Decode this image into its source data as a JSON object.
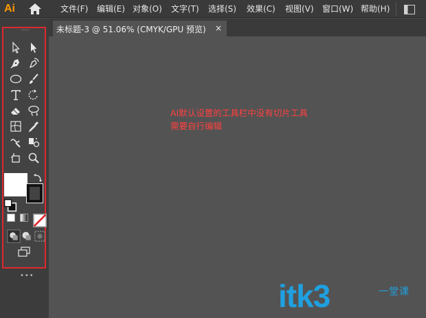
{
  "app": {
    "logo_text": "Ai",
    "accent_color": "#ff9a00"
  },
  "menu": {
    "items": [
      "文件(F)",
      "编辑(E)",
      "对象(O)",
      "文字(T)",
      "选择(S)",
      "效果(C)",
      "视图(V)",
      "窗口(W)",
      "帮助(H)"
    ]
  },
  "document_tab": {
    "label": "未标题-3 @ 51.06% (CMYK/GPU 预览)",
    "close_glyph": "×"
  },
  "annotation": {
    "text": "AI默认设置的工具栏中没有切片工具\n需要自行编辑",
    "color": "#ff4040"
  },
  "toolbar": {
    "highlight_color": "#e0282e",
    "tools": [
      "selection-tool-icon",
      "direct-selection-tool-icon",
      "pen-tool-icon",
      "curvature-tool-icon",
      "ellipse-tool-icon",
      "paintbrush-tool-icon",
      "type-tool-icon",
      "rotate-tool-icon",
      "eraser-tool-icon",
      "lasso-tool-icon",
      "mesh-tool-icon",
      "eyedropper-tool-icon",
      "warp-tool-icon",
      "symbol-sprayer-tool-icon",
      "artboard-tool-icon",
      "zoom-tool-icon"
    ],
    "fill_color": "#ffffff",
    "stroke_color": "#000000",
    "more_glyph": "•••"
  },
  "watermark": {
    "latin": "itk3",
    "chinese": "一堂课"
  }
}
